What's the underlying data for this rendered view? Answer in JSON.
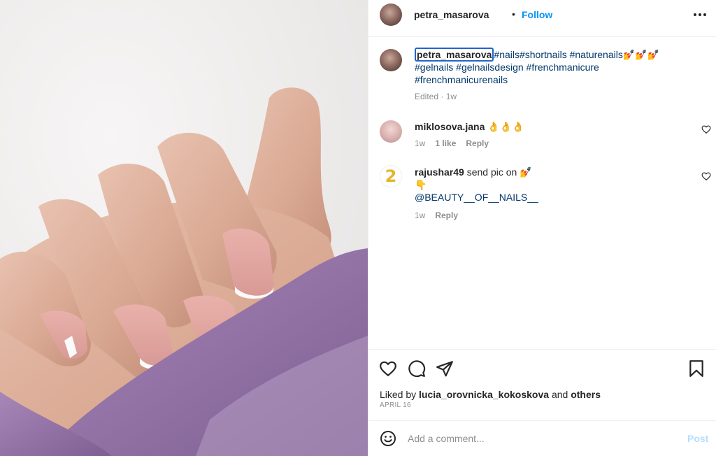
{
  "post": {
    "username": "petra_masarova",
    "separator": "•",
    "follow_label": "Follow",
    "image_alt": "Hand with French manicure nails on purple knit sleeve"
  },
  "caption": {
    "username": "petra_masarova",
    "line1_tags": "#nails#shortnails #naturenails",
    "line1_emoji": "💅💅💅",
    "line2": "#gelnails #gelnailsdesign #frenchmanicure",
    "line3": "#frenchmanicurenails",
    "meta": "Edited · 1w"
  },
  "comments": [
    {
      "username": "miklosova.jana",
      "text": "👌👌👌",
      "time": "1w",
      "likes": "1 like",
      "reply": "Reply"
    },
    {
      "username": "rajushar49",
      "text": "send pic on 💅",
      "line2": "👇",
      "mention": "@BEAUTY__OF__NAILS__",
      "avatar_text": "2",
      "time": "1w",
      "reply": "Reply"
    }
  ],
  "likes": {
    "prefix": "Liked by",
    "user": "lucia_orovnicka_kokoskova",
    "joiner": "and",
    "others": "others"
  },
  "date": "APRIL 16",
  "add_comment": {
    "placeholder": "Add a comment...",
    "post_label": "Post"
  },
  "icons": {
    "more": "more-options-icon",
    "like": "heart-icon",
    "comment": "comment-icon",
    "share": "share-icon",
    "save": "bookmark-icon",
    "emoji": "emoji-icon"
  },
  "colors": {
    "link": "#0095f6",
    "hashtag": "#00376b",
    "muted": "#8e8e8e",
    "post_disabled": "#b2dffc"
  }
}
